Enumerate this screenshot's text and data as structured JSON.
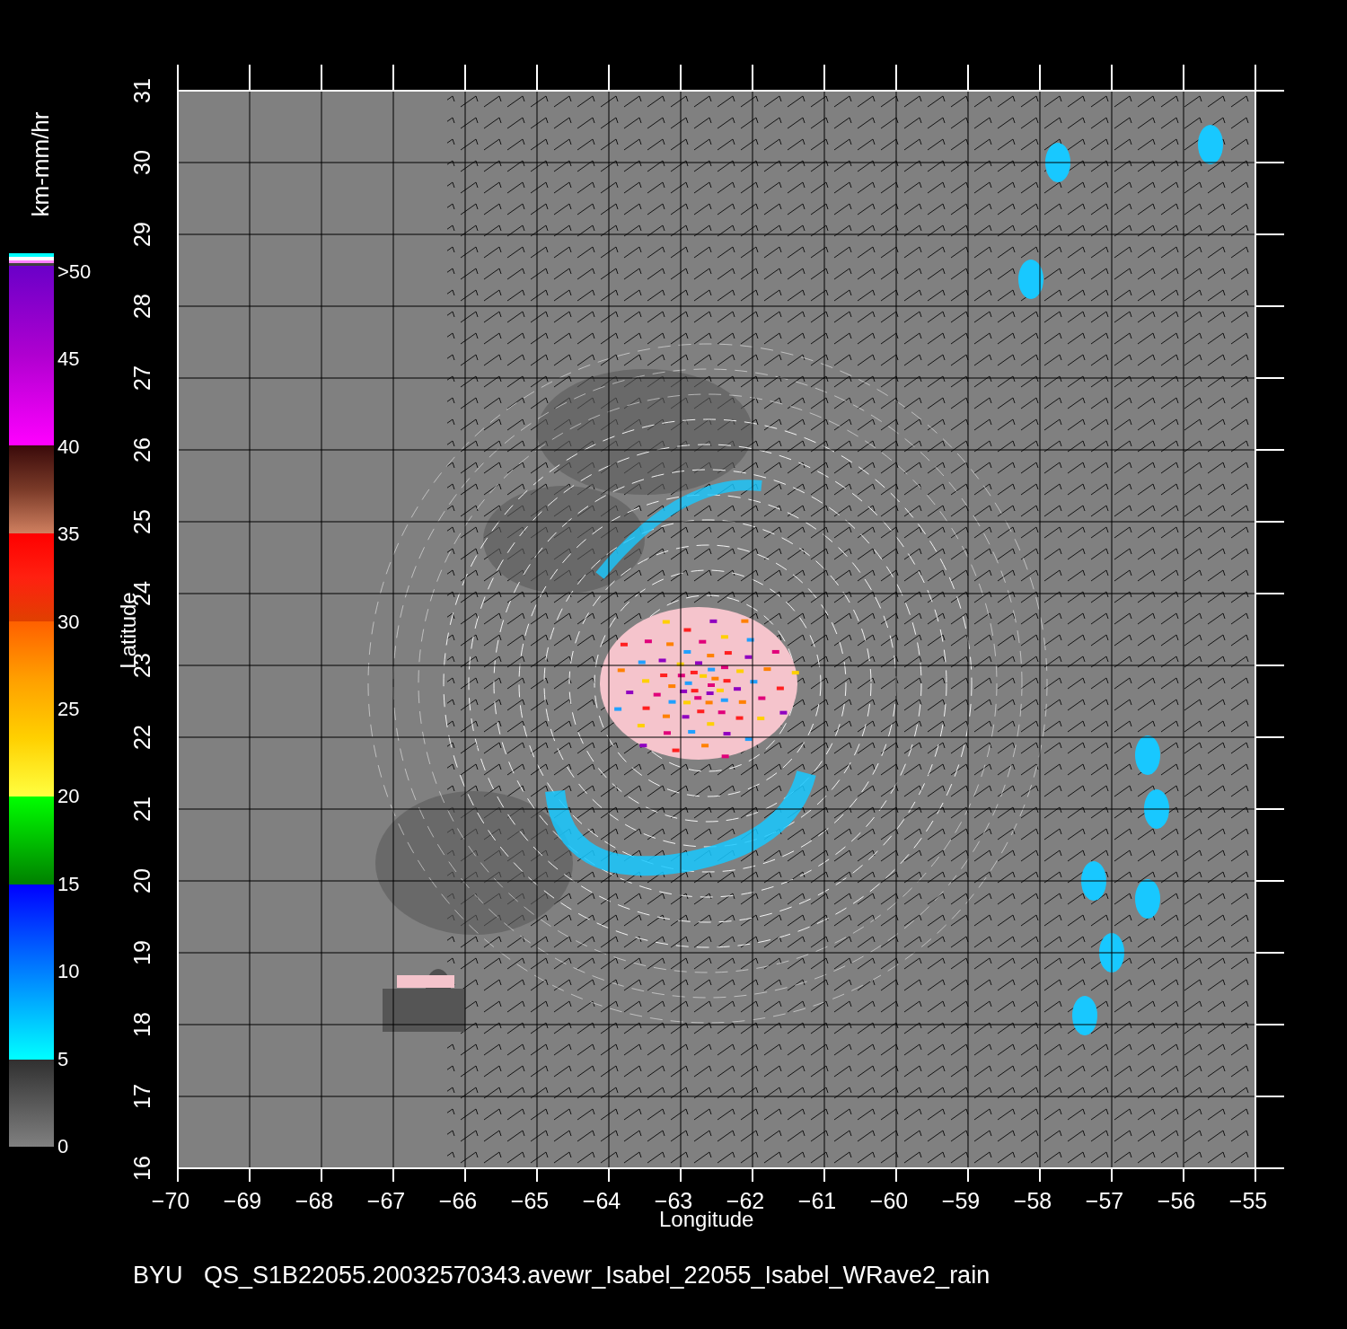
{
  "colorbar": {
    "unit": "km-mm/hr",
    "labels": [
      ">50",
      "45",
      "40",
      "35",
      "30",
      "25",
      "20",
      "15",
      "10",
      "5",
      "0"
    ]
  },
  "map": {
    "ylabel": "Latitude",
    "xlabel": "Longitude",
    "yticks": [
      "16",
      "17",
      "18",
      "19",
      "20",
      "21",
      "22",
      "23",
      "24",
      "25",
      "26",
      "27",
      "28",
      "29",
      "30",
      "31"
    ],
    "xticks": [
      "−70",
      "−69",
      "−68",
      "−67",
      "−66",
      "−65",
      "−64",
      "−63",
      "−62",
      "−61",
      "−60",
      "−59",
      "−58",
      "−57",
      "−56",
      "−55"
    ]
  },
  "caption": {
    "source": "BYU",
    "file": "QS_S1B22055.20032570343.avewr_Isabel_22055_Isabel_WRave2_rain"
  }
}
